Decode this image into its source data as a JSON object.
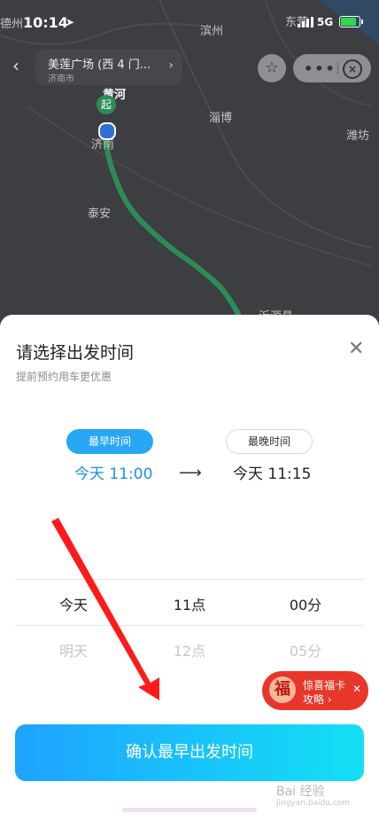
{
  "status_bar": {
    "time": "10:14",
    "network": "5G"
  },
  "map": {
    "labels": [
      "德州",
      "滨州",
      "东营",
      "黄河",
      "淄博",
      "潍坊",
      "济南",
      "泰安",
      "沂源县"
    ],
    "start_marker": "起"
  },
  "place_card": {
    "name": "美莲广场 (西 4 门...",
    "city": "济南市"
  },
  "sheet": {
    "title": "请选择出发时间",
    "subtitle": "提前预约用车更优惠",
    "earliest_label": "最早时间",
    "latest_label": "最晚时间",
    "earliest_time": "今天 11:00",
    "latest_time": "今天 11:15",
    "picker": {
      "day_selected": "今天",
      "hour_selected": "11点",
      "minute_selected": "00分",
      "day_next": "明天",
      "hour_next": "12点",
      "minute_next": "05分"
    },
    "confirm_label": "确认最早出发时间"
  },
  "promo": {
    "badge": "福",
    "line1": "惊喜福卡",
    "line2": "攻略 ›"
  },
  "watermark": {
    "brand": "Bai 经验",
    "url": "jingyan.baidu.com"
  },
  "colors": {
    "accent": "#27a7f5",
    "confirm_start": "#1ea3ff",
    "confirm_end": "#13e0f5",
    "route": "#2e8b57"
  }
}
